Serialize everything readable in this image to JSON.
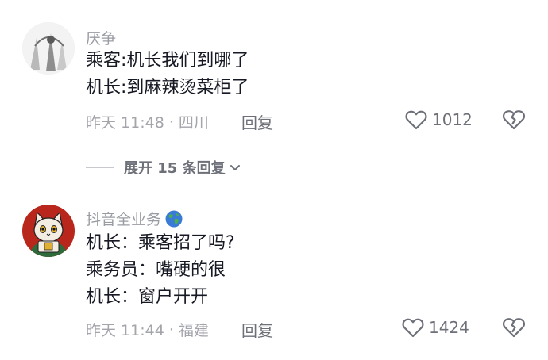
{
  "comments": [
    {
      "username": "厌争",
      "lines": [
        "乘客:机长我们到哪了",
        "机长:到麻辣烫菜柜了"
      ],
      "time": "昨天 11:48",
      "location": "四川",
      "reply_label": "回复",
      "likes": "1012",
      "avatar_icon": "grayscale-sketch-avatar"
    },
    {
      "username": "抖音全业务",
      "badge_icon": "globe-icon",
      "lines": [
        "机长：乘客招了吗?",
        "乘务员：嘴硬的很",
        "机长：窗户开开"
      ],
      "time": "昨天 11:44",
      "location": "福建",
      "reply_label": "回复",
      "likes": "1424",
      "avatar_icon": "lucky-cat-avatar"
    }
  ],
  "expand_replies": {
    "label": "展开 15 条回复"
  },
  "colors": {
    "text": "#161823",
    "secondary": "#a3a5ab",
    "action": "#6e7079",
    "cat_bg": "#b8261c"
  }
}
